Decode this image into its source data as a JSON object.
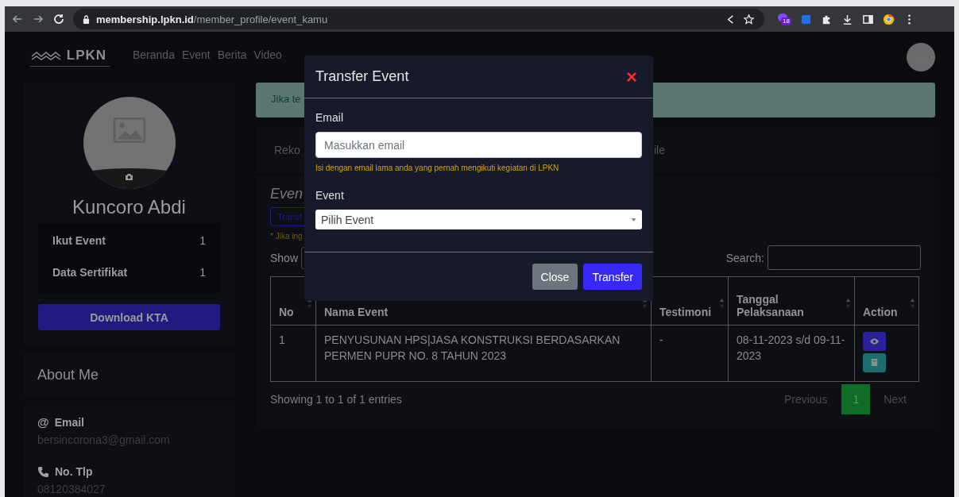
{
  "browser": {
    "url_host": "membership.lpkn.id",
    "url_path": "/member_profile/event_kamu",
    "badge": "18"
  },
  "navbar": {
    "logo": "LPKN",
    "links": [
      "Beranda",
      "Event",
      "Berita",
      "Video"
    ]
  },
  "profile": {
    "name": "Kuncoro Abdi",
    "stats": [
      {
        "label": "Ikut Event",
        "value": "1"
      },
      {
        "label": "Data Sertifikat",
        "value": "1"
      }
    ],
    "download_button": "Download KTA"
  },
  "about": {
    "title": "About Me",
    "items": [
      {
        "kind": "email",
        "icon": "@",
        "label": "Email",
        "value": "bersincorona3@gmail.com"
      },
      {
        "kind": "phone",
        "label": "No. Tlp",
        "value": "08120384027"
      }
    ]
  },
  "alert": {
    "text": "Jika te"
  },
  "tabs": [
    {
      "label": "Reko",
      "selected": false
    },
    {
      "label": "ile",
      "selected": false
    }
  ],
  "events_section": {
    "title": "Even",
    "transfer_button": "Transf",
    "note": "* Jika ing",
    "show_label": "Show",
    "search_label": "Search:"
  },
  "table": {
    "columns": [
      "No",
      "Nama Event",
      "Testimoni",
      "Tanggal Pelaksanaan",
      "Action"
    ],
    "rows": [
      {
        "no": "1",
        "name": "PENYUSUNAN HPS|JASA KONSTRUKSI BERDASARKAN PERMEN PUPR NO. 8 TAHUN 2023",
        "testimoni": "-",
        "date": "08-11-2023 s/d 09-11-2023"
      }
    ]
  },
  "footer": {
    "info": "Showing 1 to 1 of 1 entries",
    "pages": [
      {
        "label": "Previous",
        "kind": "prev",
        "selected": false
      },
      {
        "label": "1",
        "kind": "page",
        "selected": true
      },
      {
        "label": "Next",
        "kind": "next",
        "selected": false
      }
    ]
  },
  "modal": {
    "title": "Transfer Event",
    "close_icon": "×",
    "email_label": "Email",
    "email_placeholder": "Masukkan email",
    "email_help": "Isi dengan email lama anda yang pernah mengikuti kegiatan di LPKN",
    "event_label": "Event",
    "event_value": "Pilih Event",
    "buttons": [
      {
        "label": "Close",
        "kind": "secondary"
      },
      {
        "label": "Transfer",
        "kind": "primary"
      }
    ]
  }
}
